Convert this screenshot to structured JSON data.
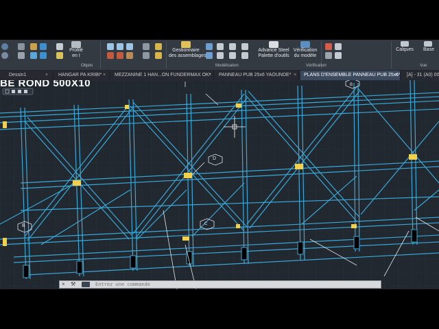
{
  "ribbon": {
    "buttons": {
      "profile_line1": "Profilé",
      "profile_line2": "en I",
      "assembly_mgr_line1": "Gestionnaire",
      "assembly_mgr_line2": "des assemblages",
      "advance_steel_line1": "Advance Steel",
      "advance_steel_line2": "Palette d'outils",
      "verify_line1": "Vérification",
      "verify_line2": "du modèle",
      "layers": "Calques",
      "base": "Base"
    },
    "groups": {
      "objets": "Objets",
      "modelisation": "Modélisation",
      "verification": "Vérification",
      "vue": "Vue"
    }
  },
  "tabs": [
    {
      "label": "Dessin1",
      "active": false
    },
    {
      "label": "HANGAR PA KRIBI*",
      "active": false
    },
    {
      "label": "MEZZANINE 1 HAN...ON FUNDERMAX OK*",
      "active": false
    },
    {
      "label": "PANNEAU PUB 25x6 YAOUNDE*",
      "active": false
    },
    {
      "label": "PLANS D'ENSEMBLE PANNEAU PUB 25x6*",
      "active": true
    },
    {
      "label": "[A] - 31 (A0) 00",
      "active": false
    }
  ],
  "viewport": {
    "title": "BE ROND 500X10",
    "markers": [
      "D",
      "B",
      "C",
      "B"
    ]
  },
  "command": {
    "placeholder": "Entrez une commande"
  },
  "colors": {
    "ribbon_bg": "#343a42",
    "tabs_bg": "#262a30",
    "viewport_bg": "#212830",
    "steel": "#3aa9d9",
    "connection": "#f2d04a"
  }
}
